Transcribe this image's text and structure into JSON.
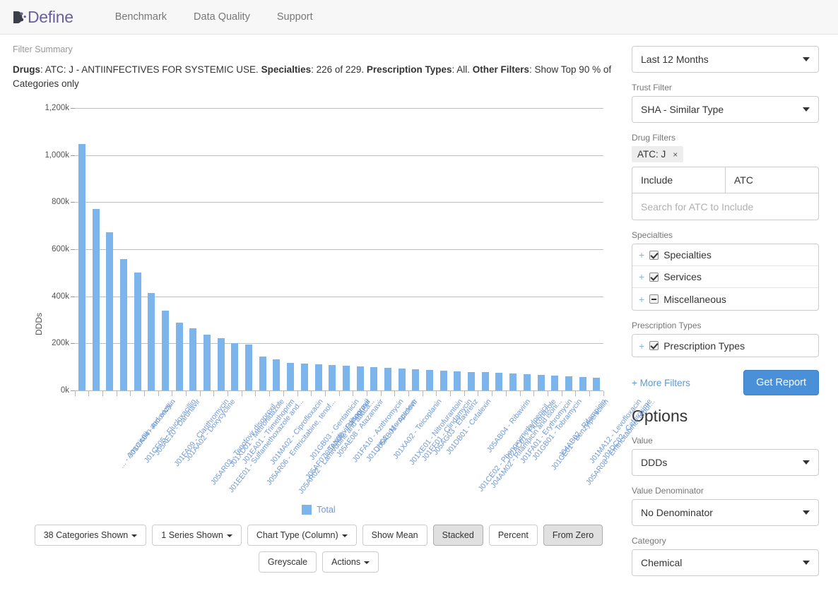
{
  "header": {
    "logo_text": "Define",
    "logo_mark_icon": "define-logo-icon",
    "nav": [
      {
        "label": "Benchmark"
      },
      {
        "label": "Data Quality"
      },
      {
        "label": "Support"
      }
    ]
  },
  "filter_summary": {
    "title": "Filter Summary",
    "segments": [
      {
        "bold": "Drugs",
        "text": ": ATC: J - ANTIINFECTIVES FOR SYSTEMIC USE. "
      },
      {
        "bold": "Specialties",
        "text": ": 226 of 229. "
      },
      {
        "bold": "Prescription Types",
        "text": ": All. "
      },
      {
        "bold": "Other Filters",
        "text": ": Show Top 90 % of Categories only"
      }
    ],
    "plain_text": "Drugs: ATC: J - ANTIINFECTIVES FOR SYSTEMIC USE. Specialties: 226 of 229. Prescription Types: All. Other Filters: Show Top 90 % of Categories only"
  },
  "chart_data": {
    "type": "bar",
    "title": "",
    "xlabel": "",
    "ylabel": "DDDs",
    "ylim": [
      0,
      1200000
    ],
    "ytick_labels": [
      "1,200k",
      "1,000k",
      "800k",
      "600k",
      "400k",
      "200k",
      "0k"
    ],
    "ytick_values": [
      1200000,
      1000000,
      800000,
      600000,
      400000,
      200000,
      0
    ],
    "grid": true,
    "legend_position": "bottom",
    "series": [
      {
        "name": "Total",
        "color": "#7cb5ec",
        "values": [
          1048000,
          772000,
          672000,
          558000,
          502000,
          415000,
          338000,
          288000,
          263000,
          236000,
          222000,
          201000,
          196000,
          144000,
          133000,
          118000,
          113000,
          110000,
          107000,
          104000,
          101000,
          99000,
          96000,
          93000,
          90000,
          87000,
          85000,
          82000,
          79000,
          77000,
          75000,
          72000,
          69000,
          66000,
          63000,
          60000,
          57000,
          54000
        ]
      }
    ],
    "categories": [
      "... - Amoxicillin and enzy...",
      "J01CA04 - Amoxicillin",
      "J01CF05 - Flucloxacillin",
      "J05AE10 - Darunavir",
      "J01FA09 - Clarithromycin",
      "J01AA02 - Doxycycline",
      "J05AR03 - Tenofovir disoproxil...",
      "J01EE01 - Sulfamethoxazole and...",
      "J01XD01 - Metronidazole",
      "J01EA01 - Trimethoprim",
      "J05AR06 - Emtricitabine, tenof...",
      "J01MA02 - Ciprofloxacin",
      "J05AR02 - Lamivudine and abaca...",
      "J05AF07 - Tenofovir disoproxil",
      "J01GB03 - Gentamicin",
      "J05AX08 - Raltegravir",
      "J05AE08 - Atazanavir",
      "J01FA10 - Azithromycin",
      "J01DH02 - Meropenem",
      "J05AB01 - Aciclovir",
      "J01XA02 - Teicoplanin",
      "J01XE01 - Nitrofurantoin",
      "J01FF01 - Clindamycin",
      "J05AG03 - Efavirenz",
      "J01DB01 - Cefalexin",
      "J01CE02 - Phenoxymethylpenicil...",
      "J04AM02 - Rifampicin and isoni...",
      "J05AB04 - Ribavirin",
      "J02AC01 - Fluconazole",
      "J01FA01 - Erythromycin",
      "J01GB01 - Tobramycin",
      "J01CE01 - Benzylpenicillin",
      "J04AB02 - Rifampicin",
      "J05AR08 - Emtricitabine, tenof...",
      "J01MA12 - Levofloxacin",
      "J01DC02 - Cefuroxime"
    ],
    "bar_count": 38,
    "legend": [
      {
        "label": "Total",
        "color": "#7cb5ec"
      }
    ]
  },
  "chart_toolbar": {
    "row1": [
      {
        "label": "38 Categories Shown",
        "caret": true,
        "active": false,
        "name": "categories-shown-button"
      },
      {
        "label": "1 Series Shown",
        "caret": true,
        "active": false,
        "name": "series-shown-button"
      },
      {
        "label": "Chart Type (Column)",
        "caret": true,
        "active": false,
        "name": "chart-type-button"
      },
      {
        "label": "Show Mean",
        "caret": false,
        "active": false,
        "name": "show-mean-button"
      },
      {
        "label": "Stacked",
        "caret": false,
        "active": true,
        "name": "stacked-button"
      },
      {
        "label": "Percent",
        "caret": false,
        "active": false,
        "name": "percent-button"
      },
      {
        "label": "From Zero",
        "caret": false,
        "active": true,
        "name": "from-zero-button"
      }
    ],
    "row2": [
      {
        "label": "Greyscale",
        "caret": false,
        "active": false,
        "name": "greyscale-button"
      },
      {
        "label": "Actions",
        "caret": true,
        "active": false,
        "name": "actions-button"
      }
    ]
  },
  "sidebar": {
    "period_select": {
      "value": "Last 12 Months"
    },
    "trust_filter": {
      "label": "Trust Filter",
      "value": "SHA - Similar Type"
    },
    "drug_filters": {
      "label": "Drug Filters",
      "tag": "ATC: J",
      "tag_remove_icon": "close-icon",
      "mode_select": "Include",
      "type_select": "ATC",
      "search_placeholder": "Search for ATC to Include",
      "search_value": ""
    },
    "specialties": {
      "label": "Specialties",
      "rows": [
        {
          "label": "Specialties",
          "state": "checked"
        },
        {
          "label": "Services",
          "state": "checked"
        },
        {
          "label": "Miscellaneous",
          "state": "indeterminate"
        }
      ]
    },
    "prescription_types": {
      "label": "Prescription Types",
      "rows": [
        {
          "label": "Prescription Types",
          "state": "checked"
        }
      ]
    },
    "more_filters": "+ More Filters",
    "get_report": "Get Report",
    "options_title": "Options",
    "value": {
      "label": "Value",
      "value": "DDDs"
    },
    "value_denominator": {
      "label": "Value Denominator",
      "value": "No Denominator"
    },
    "category": {
      "label": "Category",
      "value": "Chemical"
    }
  },
  "colors": {
    "bar": "#7cb5ec",
    "accent": "#4a90d9",
    "brand": "#6b5f9e",
    "axis_label": "#6f9ad6"
  }
}
